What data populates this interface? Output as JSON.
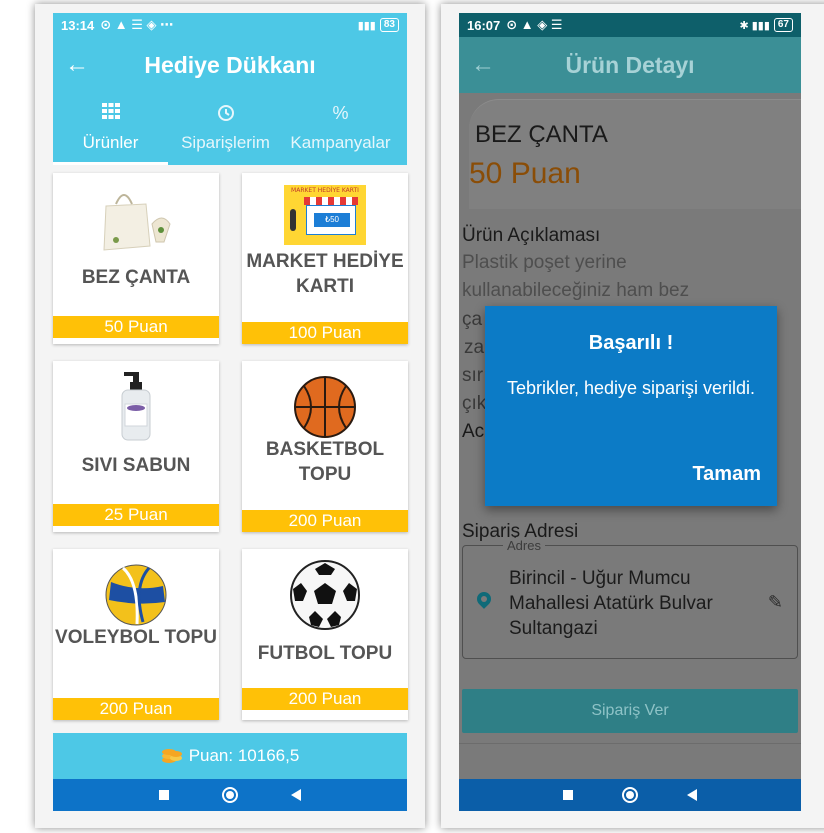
{
  "left": {
    "status": {
      "time": "13:14",
      "battery": "83"
    },
    "title": "Hediye Dükkanı",
    "tabs": [
      {
        "label": "Ürünler",
        "icon": "grid-icon"
      },
      {
        "label": "Siparişlerim",
        "icon": "history-icon"
      },
      {
        "label": "Kampanyalar",
        "icon": "percent-icon"
      }
    ],
    "products": [
      {
        "name": "BEZ ÇANTA",
        "price": "50 Puan"
      },
      {
        "name": "MARKET HEDİYE KARTI",
        "price": "100 Puan",
        "image_text": "MARKET HEDİYE KARTI",
        "image_value": "₺50"
      },
      {
        "name": "SIVI SABUN",
        "price": "25 Puan"
      },
      {
        "name": "BASKETBOL TOPU",
        "price": "200 Puan"
      },
      {
        "name": "VOLEYBOL TOPU",
        "price": "200 Puan"
      },
      {
        "name": "FUTBOL TOPU",
        "price": "200 Puan"
      }
    ],
    "points": "Puan: 10166,5"
  },
  "right": {
    "status": {
      "time": "16:07",
      "battery": "67"
    },
    "title": "Ürün Detayı",
    "product_name": "BEZ ÇANTA",
    "product_points": "50 Puan",
    "desc_title": "Ürün Açıklaması",
    "desc_lines": [
      "Plastik poşet yerine",
      "kullanabileceğiniz ham bez"
    ],
    "desc_fragments": [
      "ça",
      "za",
      "sır",
      "çık"
    ],
    "ac_fragment": "Ac",
    "address_title": "Sipariş Adresi",
    "address_legend": "Adres",
    "address_text": "Birincil - Uğur Mumcu Mahallesi Atatürk Bulvar Sultangazi",
    "order_button": "Sipariş Ver",
    "dialog": {
      "title": "Başarılı !",
      "message": "Tebrikler, hediye siparişi verildi.",
      "ok": "Tamam"
    }
  },
  "colors": {
    "primary": "#4dc8e6",
    "price_bar": "#ffc107",
    "nav": "#0d73c8",
    "dialog": "#0c7bc6"
  }
}
